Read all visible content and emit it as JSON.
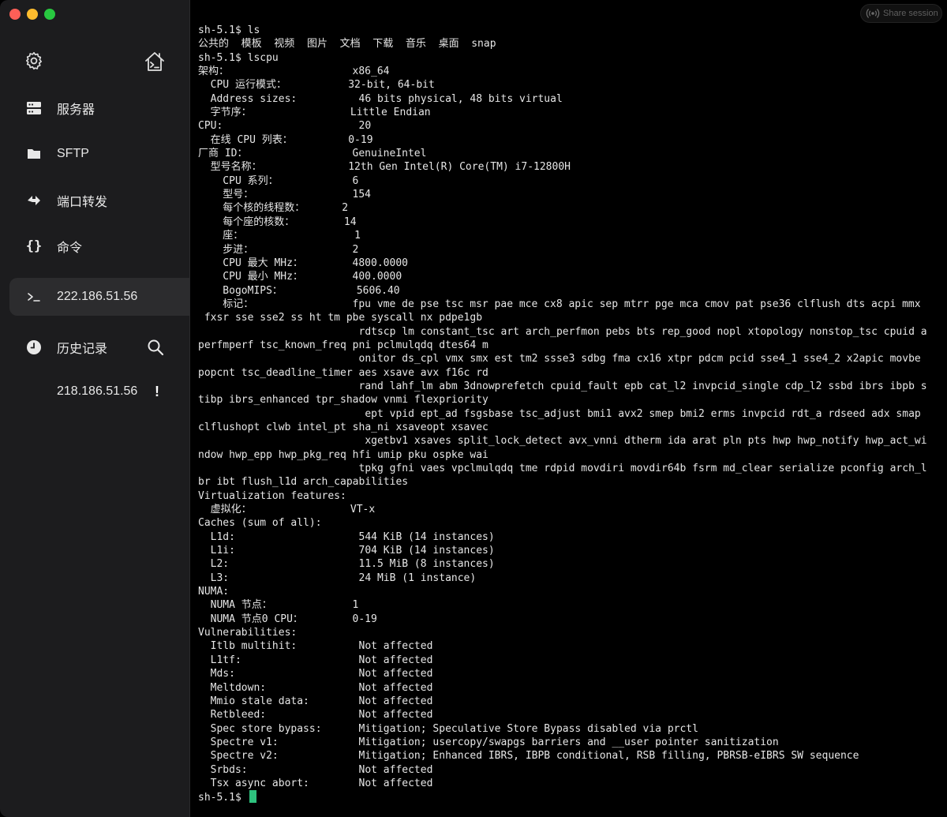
{
  "sidebar": {
    "top_icons": [
      "gear-icon",
      "home-terminal-icon"
    ],
    "items": [
      {
        "label": "服务器",
        "icon": "server-icon"
      },
      {
        "label": "SFTP",
        "icon": "folder-icon"
      },
      {
        "label": "端口转发",
        "icon": "port-forward-icon"
      },
      {
        "label": "命令",
        "icon": "braces-icon"
      }
    ],
    "active_session": {
      "label": "222.186.51.56",
      "icon": "terminal-prompt-icon"
    },
    "history": {
      "label": "历史记录",
      "icon": "clock-icon",
      "search_icon": "search-icon"
    },
    "history_items": [
      {
        "label": "218.186.51.56",
        "badge": "!"
      }
    ]
  },
  "share_button": {
    "label": "Share session",
    "icon": "broadcast-icon"
  },
  "terminal": {
    "lines": [
      "sh-5.1$ ls",
      "公共的  模板  视频  图片  文档  下载  音乐  桌面  snap",
      "sh-5.1$ lscpu",
      "架构：                    x86_64",
      "  CPU 运行模式：          32-bit, 64-bit",
      "  Address sizes:          46 bits physical, 48 bits virtual",
      "  字节序：                Little Endian",
      "CPU:                      20",
      "  在线 CPU 列表：         0-19",
      "厂商 ID：                 GenuineIntel",
      "  型号名称：              12th Gen Intel(R) Core(TM) i7-12800H",
      "    CPU 系列：            6",
      "    型号：                154",
      "    每个核的线程数：      2",
      "    每个座的核数：        14",
      "    座：                  1",
      "    步进：                2",
      "    CPU 最大 MHz：        4800.0000",
      "    CPU 最小 MHz：        400.0000",
      "    BogoMIPS：            5606.40",
      "    标记：                fpu vme de pse tsc msr pae mce cx8 apic sep mtrr pge mca cmov pat pse36 clflush dts acpi mmx",
      " fxsr sse sse2 ss ht tm pbe syscall nx pdpe1gb",
      "                          rdtscp lm constant_tsc art arch_perfmon pebs bts rep_good nopl xtopology nonstop_tsc cpuid a",
      "perfmperf tsc_known_freq pni pclmulqdq dtes64 m",
      "                          onitor ds_cpl vmx smx est tm2 ssse3 sdbg fma cx16 xtpr pdcm pcid sse4_1 sse4_2 x2apic movbe",
      "popcnt tsc_deadline_timer aes xsave avx f16c rd",
      "                          rand lahf_lm abm 3dnowprefetch cpuid_fault epb cat_l2 invpcid_single cdp_l2 ssbd ibrs ibpb s",
      "tibp ibrs_enhanced tpr_shadow vnmi flexpriority",
      "                           ept vpid ept_ad fsgsbase tsc_adjust bmi1 avx2 smep bmi2 erms invpcid rdt_a rdseed adx smap",
      "clflushopt clwb intel_pt sha_ni xsaveopt xsavec",
      "                           xgetbv1 xsaves split_lock_detect avx_vnni dtherm ida arat pln pts hwp hwp_notify hwp_act_wi",
      "ndow hwp_epp hwp_pkg_req hfi umip pku ospke wai",
      "                          tpkg gfni vaes vpclmulqdq tme rdpid movdiri movdir64b fsrm md_clear serialize pconfig arch_l",
      "br ibt flush_l1d arch_capabilities",
      "Virtualization features:",
      "  虚拟化：                VT-x",
      "Caches (sum of all):",
      "  L1d:                    544 KiB (14 instances)",
      "  L1i:                    704 KiB (14 instances)",
      "  L2:                     11.5 MiB (8 instances)",
      "  L3:                     24 MiB (1 instance)",
      "NUMA:",
      "  NUMA 节点：             1",
      "  NUMA 节点0 CPU：        0-19",
      "Vulnerabilities:",
      "  Itlb multihit:          Not affected",
      "  L1tf:                   Not affected",
      "  Mds:                    Not affected",
      "  Meltdown:               Not affected",
      "  Mmio stale data:        Not affected",
      "  Retbleed:               Not affected",
      "  Spec store bypass:      Mitigation; Speculative Store Bypass disabled via prctl",
      "  Spectre v1:             Mitigation; usercopy/swapgs barriers and __user pointer sanitization",
      "  Spectre v2:             Mitigation; Enhanced IBRS, IBPB conditional, RSB filling, PBRSB-eIBRS SW sequence",
      "  Srbds:                  Not affected",
      "  Tsx async abort:        Not affected"
    ],
    "prompt": "sh-5.1$ ",
    "cursor_color": "#2ec27e"
  }
}
